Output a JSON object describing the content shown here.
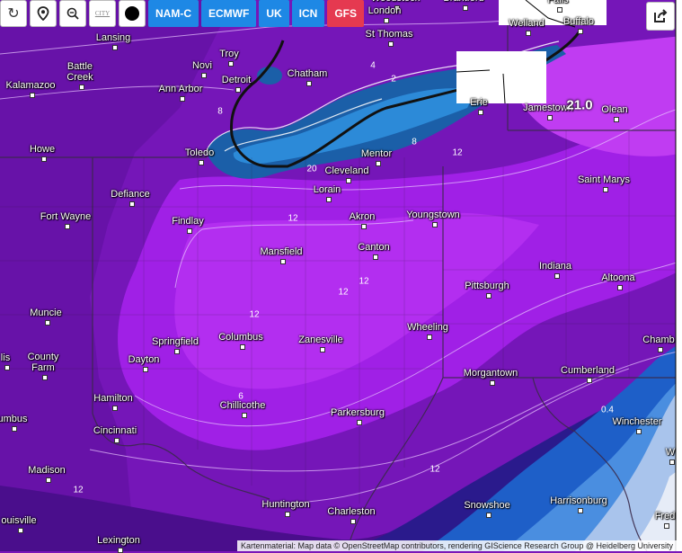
{
  "toolbar": {
    "icons": [
      "refresh-icon",
      "location-pin-icon",
      "zoom-out-icon",
      "city-toggle-icon",
      "dot-icon"
    ],
    "city_toggle_label": "CITY",
    "models": [
      {
        "label": "NAM-C",
        "color": "#1e88e5"
      },
      {
        "label": "ECMWF",
        "color": "#1e88e5"
      },
      {
        "label": "UK",
        "color": "#1e88e5"
      },
      {
        "label": "ICN",
        "color": "#1e88e5"
      },
      {
        "label": "GFS",
        "color": "#e53950"
      }
    ],
    "share_icon": "share-icon"
  },
  "map": {
    "max_value": "21.0",
    "contour_labels": [
      {
        "text": "4"
      },
      {
        "text": "2"
      },
      {
        "text": "8"
      },
      {
        "text": "8"
      },
      {
        "text": "12"
      },
      {
        "text": "20"
      },
      {
        "text": "12"
      },
      {
        "text": "12"
      },
      {
        "text": "12"
      },
      {
        "text": "12"
      },
      {
        "text": "6"
      },
      {
        "text": "12"
      },
      {
        "text": "12"
      },
      {
        "text": "0.4"
      }
    ],
    "cities": [
      {
        "name": "Woodstock"
      },
      {
        "name": "Brantford"
      },
      {
        "name": "Falls"
      },
      {
        "name": "London"
      },
      {
        "name": "Lansing"
      },
      {
        "name": "Welland"
      },
      {
        "name": "Buffalo"
      },
      {
        "name": "St Thomas"
      },
      {
        "name": "Troy"
      },
      {
        "name": "Battle Creek"
      },
      {
        "name": "Novi"
      },
      {
        "name": "Kalamazoo"
      },
      {
        "name": "Detroit"
      },
      {
        "name": "Chatham"
      },
      {
        "name": "Ann Arbor"
      },
      {
        "name": "Erie"
      },
      {
        "name": "Jamestown"
      },
      {
        "name": "Olean"
      },
      {
        "name": "Howe"
      },
      {
        "name": "Toledo"
      },
      {
        "name": "Mentor"
      },
      {
        "name": "Cleveland"
      },
      {
        "name": "Lorain"
      },
      {
        "name": "Saint Marys"
      },
      {
        "name": "Defiance"
      },
      {
        "name": "Fort Wayne"
      },
      {
        "name": "Findlay"
      },
      {
        "name": "Akron"
      },
      {
        "name": "Youngstown"
      },
      {
        "name": "Mansfield"
      },
      {
        "name": "Canton"
      },
      {
        "name": "Indiana"
      },
      {
        "name": "Altoona"
      },
      {
        "name": "Pittsburgh"
      },
      {
        "name": "Muncie"
      },
      {
        "name": "Columbus"
      },
      {
        "name": "Springfield"
      },
      {
        "name": "Zanesville"
      },
      {
        "name": "Wheeling"
      },
      {
        "name": "Dayton"
      },
      {
        "name": "Chamb"
      },
      {
        "name": "County Farm"
      },
      {
        "name": "lis"
      },
      {
        "name": "Cumberland"
      },
      {
        "name": "Morgantown"
      },
      {
        "name": "Hamilton"
      },
      {
        "name": "Chillicothe"
      },
      {
        "name": "Winchester"
      },
      {
        "name": "Parkersburg"
      },
      {
        "name": "umbus"
      },
      {
        "name": "Cincinnati"
      },
      {
        "name": "W"
      },
      {
        "name": "Madison"
      },
      {
        "name": "Harrisonburg"
      },
      {
        "name": "Snowshoe"
      },
      {
        "name": "Huntington"
      },
      {
        "name": "Charleston"
      },
      {
        "name": "ouisville"
      },
      {
        "name": "Fred"
      },
      {
        "name": "Lexington"
      }
    ]
  },
  "attribution": "Kartenmaterial: Map data © OpenStreetMap contributors, rendering GIScience Research Group @ Heidelberg University"
}
